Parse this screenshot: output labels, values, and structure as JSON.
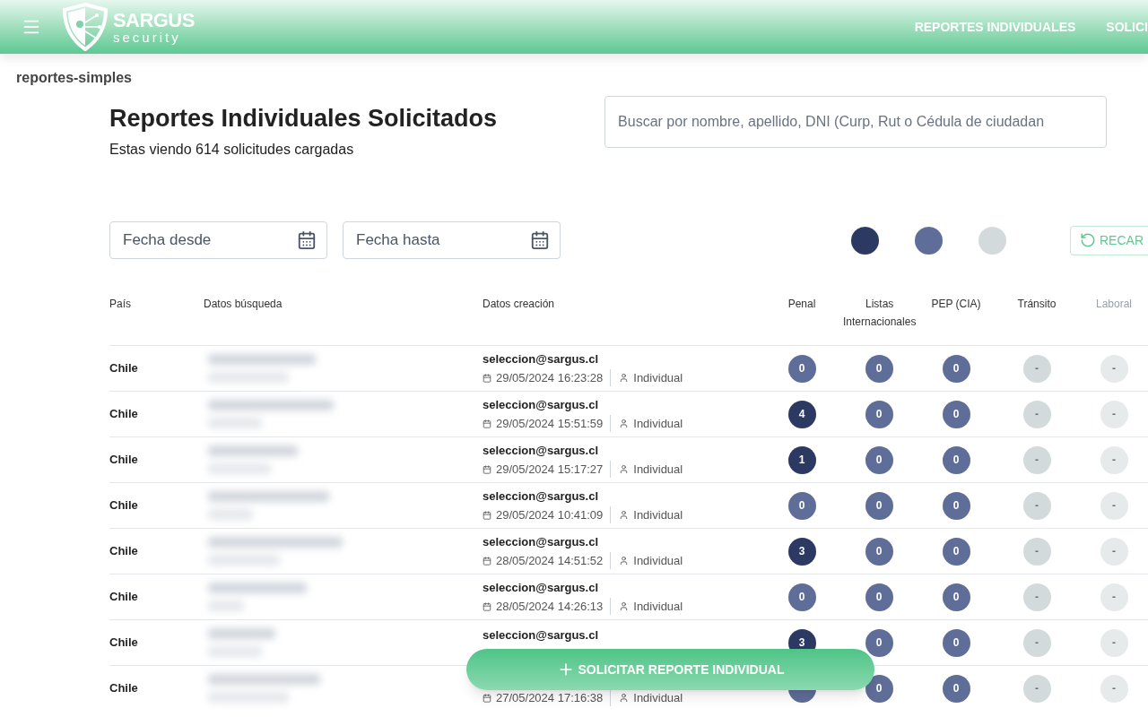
{
  "header": {
    "logo": {
      "name": "SARGUS",
      "tagline": "security"
    },
    "nav": [
      {
        "label": "REPORTES INDIVIDUALES"
      },
      {
        "label": "SOLICI"
      }
    ]
  },
  "breadcrumb": "reportes-simples",
  "title": "Reportes Individuales Solicitados",
  "subtitle": "Estas viendo 614 solicitudes cargadas",
  "search": {
    "placeholder": "Buscar por nombre, apellido, DNI (Curp, Rut o Cédula de ciudadan"
  },
  "date_from": {
    "placeholder": "Fecha desde"
  },
  "date_to": {
    "placeholder": "Fecha hasta"
  },
  "legend": [
    {
      "color": "#2c3a63"
    },
    {
      "color": "#5f6e98"
    },
    {
      "color": "#d3dadc"
    }
  ],
  "reload_button": "RECAR",
  "table": {
    "columns": [
      "País",
      "Datos búsqueda",
      "Datos creación",
      "Penal",
      "Listas Internacionales",
      "PEP (CIA)",
      "Tránsito",
      "Laboral"
    ],
    "rows": [
      {
        "country": "Chile",
        "email": "seleccion@sargus.cl",
        "date": "29/05/2024 16:23:28",
        "type": "Individual",
        "badges": [
          {
            "value": "0",
            "color": "#5f6e98"
          },
          {
            "value": "0",
            "color": "#5f6e98"
          },
          {
            "value": "0",
            "color": "#5f6e98"
          },
          {
            "value": "-",
            "color": "#d3dadc"
          },
          {
            "value": "-",
            "color": "#e6eaeb"
          }
        ]
      },
      {
        "country": "Chile",
        "email": "seleccion@sargus.cl",
        "date": "29/05/2024 15:51:59",
        "type": "Individual",
        "badges": [
          {
            "value": "4",
            "color": "#2c3a63"
          },
          {
            "value": "0",
            "color": "#5f6e98"
          },
          {
            "value": "0",
            "color": "#5f6e98"
          },
          {
            "value": "-",
            "color": "#d3dadc"
          },
          {
            "value": "-",
            "color": "#e6eaeb"
          }
        ]
      },
      {
        "country": "Chile",
        "email": "seleccion@sargus.cl",
        "date": "29/05/2024 15:17:27",
        "type": "Individual",
        "badges": [
          {
            "value": "1",
            "color": "#2c3a63"
          },
          {
            "value": "0",
            "color": "#5f6e98"
          },
          {
            "value": "0",
            "color": "#5f6e98"
          },
          {
            "value": "-",
            "color": "#d3dadc"
          },
          {
            "value": "-",
            "color": "#e6eaeb"
          }
        ]
      },
      {
        "country": "Chile",
        "email": "seleccion@sargus.cl",
        "date": "29/05/2024 10:41:09",
        "type": "Individual",
        "badges": [
          {
            "value": "0",
            "color": "#5f6e98"
          },
          {
            "value": "0",
            "color": "#5f6e98"
          },
          {
            "value": "0",
            "color": "#5f6e98"
          },
          {
            "value": "-",
            "color": "#d3dadc"
          },
          {
            "value": "-",
            "color": "#e6eaeb"
          }
        ]
      },
      {
        "country": "Chile",
        "email": "seleccion@sargus.cl",
        "date": "28/05/2024 14:51:52",
        "type": "Individual",
        "badges": [
          {
            "value": "3",
            "color": "#2c3a63"
          },
          {
            "value": "0",
            "color": "#5f6e98"
          },
          {
            "value": "0",
            "color": "#5f6e98"
          },
          {
            "value": "-",
            "color": "#d3dadc"
          },
          {
            "value": "-",
            "color": "#e6eaeb"
          }
        ]
      },
      {
        "country": "Chile",
        "email": "seleccion@sargus.cl",
        "date": "28/05/2024 14:26:13",
        "type": "Individual",
        "badges": [
          {
            "value": "0",
            "color": "#5f6e98"
          },
          {
            "value": "0",
            "color": "#5f6e98"
          },
          {
            "value": "0",
            "color": "#5f6e98"
          },
          {
            "value": "-",
            "color": "#d3dadc"
          },
          {
            "value": "-",
            "color": "#e6eaeb"
          }
        ]
      },
      {
        "country": "Chile",
        "email": "seleccion@sargus.cl",
        "badges": [
          {
            "value": "3",
            "color": "#2c3a63"
          },
          {
            "value": "0",
            "color": "#5f6e98"
          },
          {
            "value": "0",
            "color": "#5f6e98"
          },
          {
            "value": "-",
            "color": "#d3dadc"
          },
          {
            "value": "-",
            "color": "#e6eaeb"
          }
        ]
      },
      {
        "country": "Chile",
        "date": "27/05/2024 17:16:38",
        "type": "Individual",
        "badges": [
          {
            "color": "#5f6e98"
          },
          {
            "value": "0",
            "color": "#5f6e98"
          },
          {
            "value": "0",
            "color": "#5f6e98"
          },
          {
            "value": "-",
            "color": "#d3dadc"
          },
          {
            "value": "-",
            "color": "#e6eaeb"
          }
        ]
      }
    ]
  },
  "fab": "SOLICITAR REPORTE INDIVIDUAL"
}
